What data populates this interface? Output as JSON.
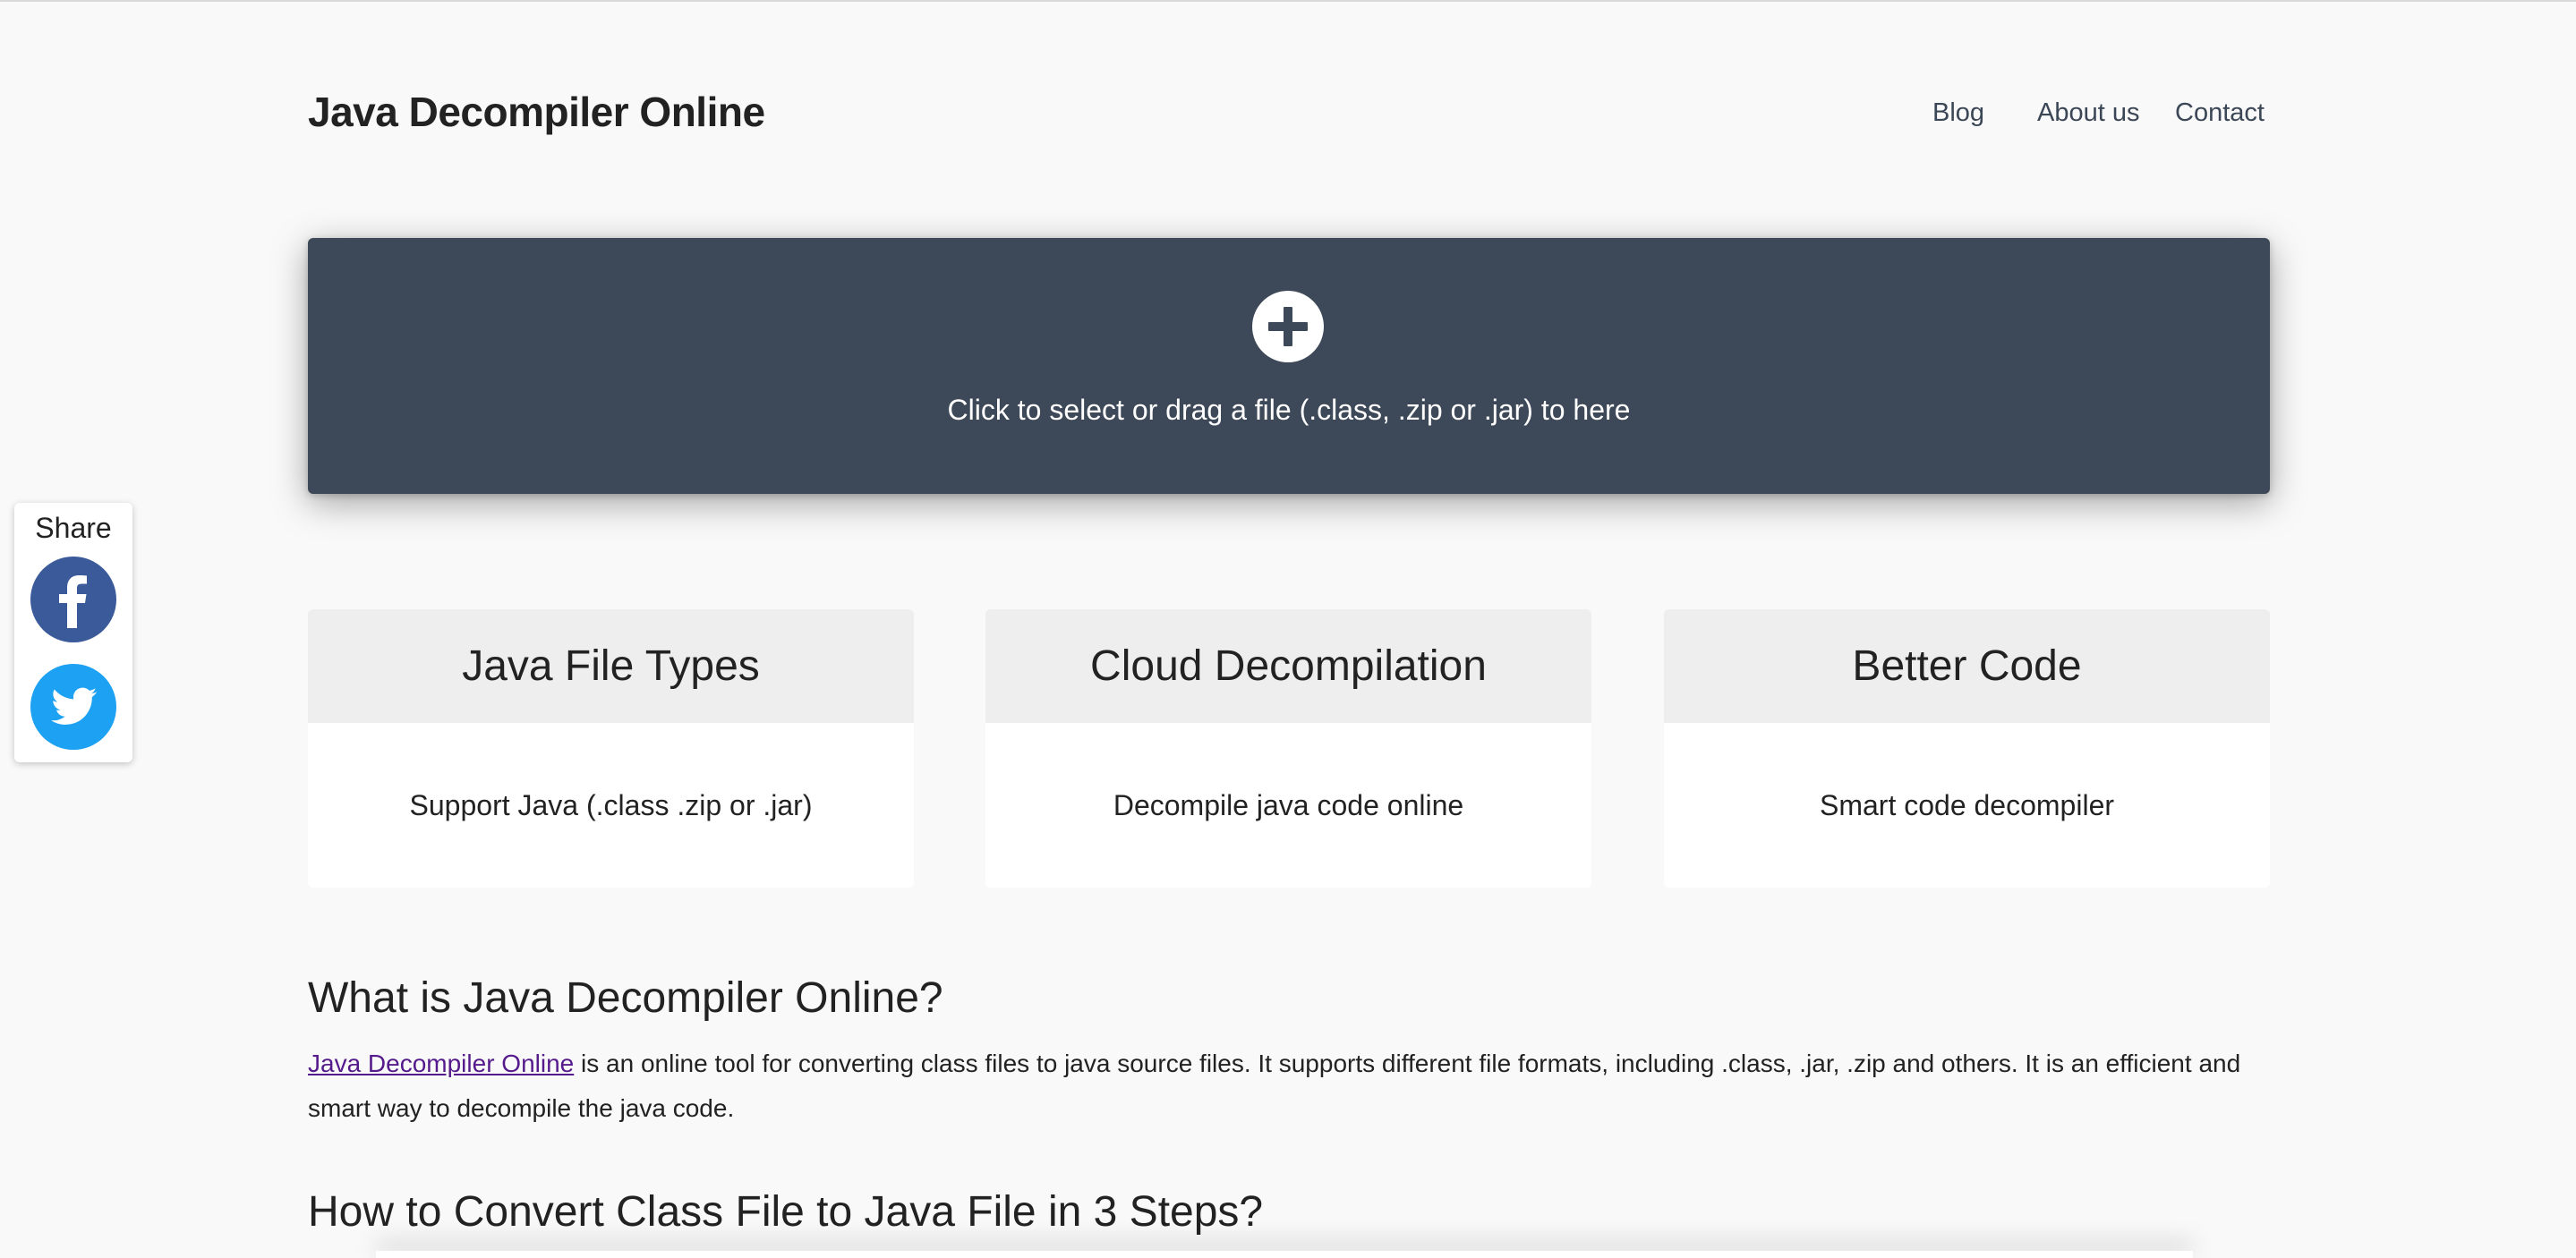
{
  "header": {
    "title": "Java Decompiler Online",
    "nav": [
      {
        "label": "Blog"
      },
      {
        "label": "About us"
      },
      {
        "label": "Contact"
      }
    ]
  },
  "dropzone": {
    "icon": "plus-circle-icon",
    "text": "Click to select or drag a file (.class, .zip or .jar) to here"
  },
  "share": {
    "label": "Share",
    "buttons": [
      {
        "icon": "facebook-icon",
        "color": "#3b5a9a"
      },
      {
        "icon": "twitter-icon",
        "color": "#1da1f2"
      }
    ]
  },
  "features": [
    {
      "title": "Java File Types",
      "text": "Support Java (.class .zip or .jar)"
    },
    {
      "title": "Cloud Decompilation",
      "text": "Decompile java code online"
    },
    {
      "title": "Better Code",
      "text": "Smart code decompiler"
    }
  ],
  "article": {
    "heading1": "What is Java Decompiler Online?",
    "link_text": "Java Decompiler Online",
    "paragraph_rest": " is an online tool for converting class files to java source files. It supports different file formats, including .class, .jar, .zip and others. It is an efficient and smart way to decompile the java code.",
    "heading2": "How to Convert Class File to Java File in 3 Steps?"
  },
  "colors": {
    "background": "#f9f9f9",
    "dropzone": "#3d4858",
    "nav_text": "#3b4656",
    "card_header": "#eeeeee",
    "link": "#551a8b"
  }
}
